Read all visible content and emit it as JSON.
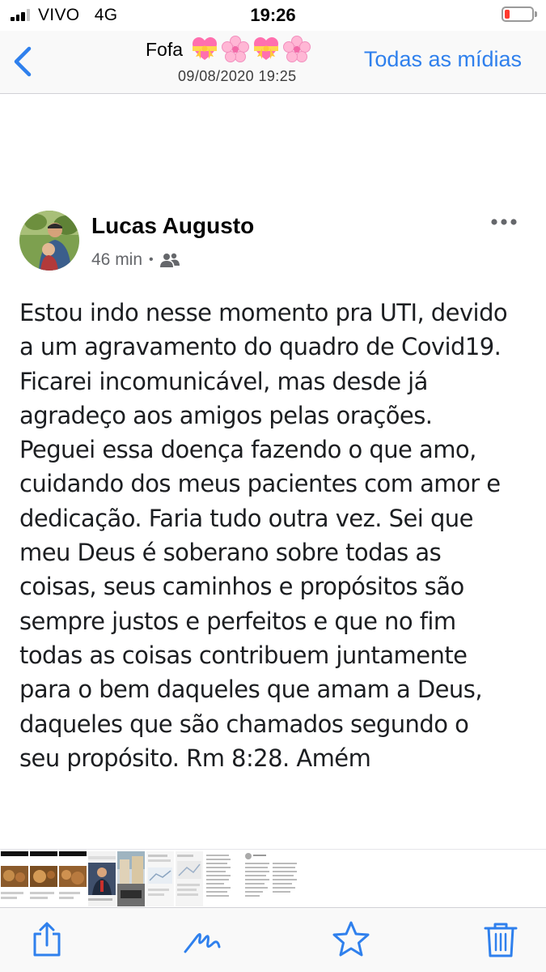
{
  "status_bar": {
    "carrier": "VIVO",
    "network": "4G",
    "time": "19:26",
    "battery_level": 0.15,
    "battery_color": "#ff3b30"
  },
  "nav": {
    "back_icon": "chevron-left-icon",
    "title": "Fofa",
    "title_emojis": [
      "heart-ribbon",
      "cherry-blossom",
      "heart-ribbon",
      "cherry-blossom"
    ],
    "subtitle": "09/08/2020 19:25",
    "all_media_label": "Todas as mídias",
    "accent_color": "#2f80ed"
  },
  "post": {
    "author": "Lucas Augusto",
    "time_ago": "46 min",
    "separator": "•",
    "audience_icon": "friends-icon",
    "more_icon": "more-horizontal-icon",
    "text": "Estou indo nesse momento pra UTI, devido\na um agravamento do quadro de Covid19.\nFicarei incomunicável, mas desde já\nagradeço aos amigos pelas orações.\nPeguei essa doença fazendo o que amo,\ncuidando dos meus pacientes com amor e\ndedicação. Faria tudo outra vez. Sei que\nmeu Deus é soberano sobre todas as\ncoisas, seus caminhos e propósitos são\nsempre justos e perfeitos e que no fim\ntodas as coisas contribuem juntamente\npara o bem daqueles que amam a Deus,\ndaqueles que são chamados segundo o\nseu propósito. Rm 8:28. Amém"
  },
  "thumbnails": [
    {
      "kind": "food-photo"
    },
    {
      "kind": "food-photo"
    },
    {
      "kind": "food-photo"
    },
    {
      "kind": "person-photo"
    },
    {
      "kind": "street-photo"
    },
    {
      "kind": "screenshot"
    },
    {
      "kind": "screenshot"
    },
    {
      "kind": "text-screenshot"
    },
    {
      "kind": "post-screenshot"
    },
    {
      "kind": "post-screenshot"
    }
  ],
  "toolbar": {
    "share_icon": "share-icon",
    "markup_icon": "markup-icon",
    "favorite_icon": "star-icon",
    "delete_icon": "trash-icon",
    "icon_color": "#2f80ed"
  }
}
